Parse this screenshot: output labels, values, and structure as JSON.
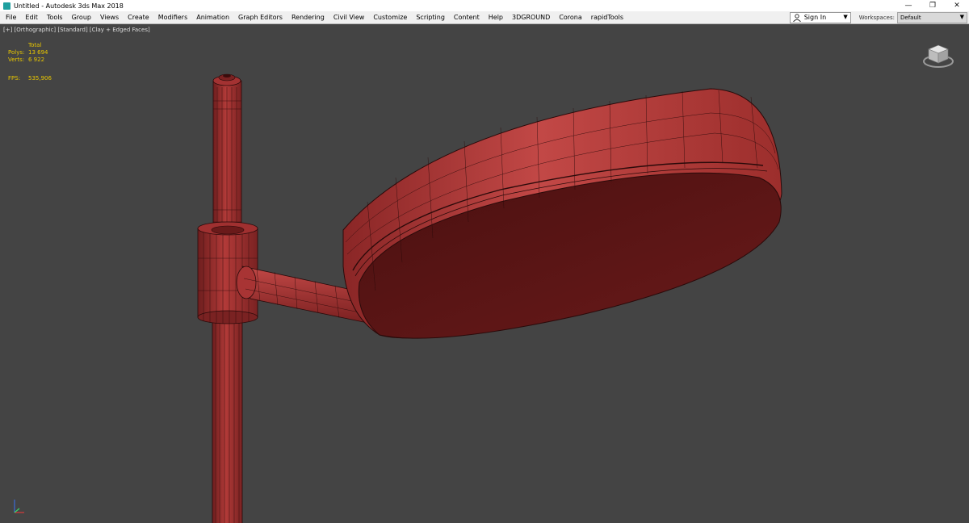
{
  "window": {
    "title": "Untitled - Autodesk 3ds Max 2018",
    "minimize_glyph": "—",
    "restore_glyph": "❐",
    "close_glyph": "✕"
  },
  "menu": {
    "items": [
      "File",
      "Edit",
      "Tools",
      "Group",
      "Views",
      "Create",
      "Modifiers",
      "Animation",
      "Graph Editors",
      "Rendering",
      "Civil View",
      "Customize",
      "Scripting",
      "Content",
      "Help",
      "3DGROUND",
      "Corona",
      "rapidTools"
    ],
    "sign_in": "Sign In",
    "workspaces_label": "Workspaces:",
    "workspace_value": "Default",
    "dropdown_glyph": "▼"
  },
  "viewport": {
    "label": "[+] [Orthographic] [Standard] [Clay + Edged Faces]",
    "stats": {
      "total_label": "Total",
      "polys_label": "Polys:",
      "polys_value": "13 694",
      "verts_label": "Verts:",
      "verts_value": "6 922",
      "fps_label": "FPS:",
      "fps_value": "535,906"
    }
  },
  "colors": {
    "viewport_bg": "#444444",
    "clay": "#b23a38",
    "clay_dark": "#5a1414",
    "wire": "#2a0a0a",
    "stats_text": "#e8c600"
  },
  "icons": {
    "app": "3ds-max-app-icon",
    "user": "user-icon",
    "viewcube": "viewcube-icon",
    "axis": "axis-tripod-icon"
  }
}
